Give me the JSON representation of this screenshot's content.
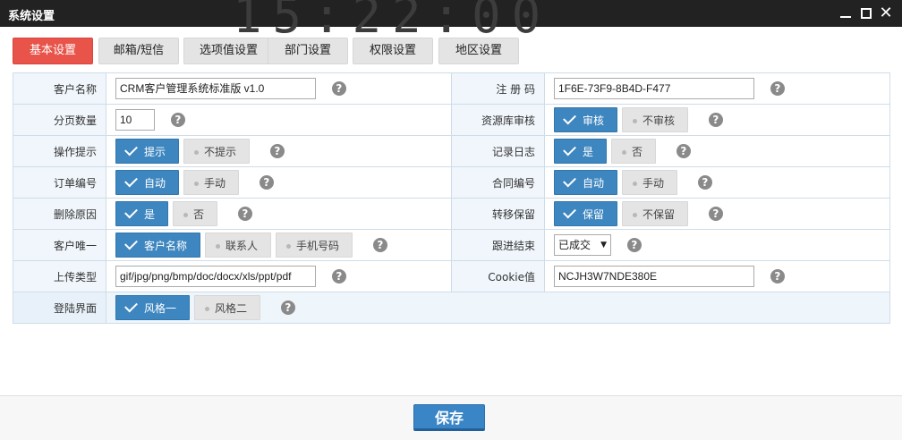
{
  "window": {
    "title": "系统设置",
    "clock": "15:22:00"
  },
  "tabs": [
    "基本设置",
    "邮箱/短信",
    "选项值设置",
    "部门设置",
    "权限设置",
    "地区设置"
  ],
  "help_glyph": "?",
  "rows": {
    "customer_name": {
      "label": "客户名称",
      "value": "CRM客户管理系统标准版 v1.0"
    },
    "reg_code": {
      "label": "注 册 码",
      "value": "1F6E-73F9-8B4D-F477"
    },
    "page_size": {
      "label": "分页数量",
      "value": "10"
    },
    "resource_review": {
      "label": "资源库审核",
      "on": "审核",
      "off": "不审核"
    },
    "op_hint": {
      "label": "操作提示",
      "on": "提示",
      "off": "不提示"
    },
    "log": {
      "label": "记录日志",
      "on": "是",
      "off": "否"
    },
    "order_no": {
      "label": "订单编号",
      "on": "自动",
      "off": "手动"
    },
    "contract_no": {
      "label": "合同编号",
      "on": "自动",
      "off": "手动"
    },
    "delete_reason": {
      "label": "删除原因",
      "on": "是",
      "off": "否"
    },
    "transfer_keep": {
      "label": "转移保留",
      "on": "保留",
      "off": "不保留"
    },
    "customer_unique": {
      "label": "客户唯一",
      "on": "客户名称",
      "off1": "联系人",
      "off2": "手机号码"
    },
    "follow_end": {
      "label": "跟进结束",
      "value": "已成交"
    },
    "upload_type": {
      "label": "上传类型",
      "value": "gif/jpg/png/bmp/doc/docx/xls/ppt/pdf"
    },
    "cookie": {
      "label": "Cookie值",
      "value": "NCJH3W7NDE380E"
    },
    "login_ui": {
      "label": "登陆界面",
      "on": "风格一",
      "off": "风格二"
    }
  },
  "footer": {
    "save_label": "保存"
  }
}
